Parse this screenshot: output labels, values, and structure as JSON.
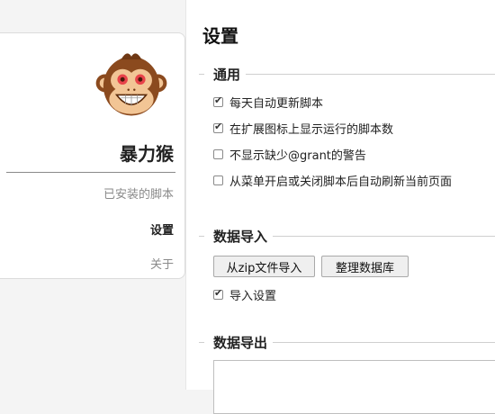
{
  "sidebar": {
    "app_name": "暴力猴",
    "items": [
      {
        "label": "已安装的脚本",
        "active": false
      },
      {
        "label": "设置",
        "active": true
      },
      {
        "label": "关于",
        "active": false
      }
    ]
  },
  "main": {
    "title": "设置",
    "sections": {
      "general": {
        "title": "通用",
        "options": [
          {
            "label": "每天自动更新脚本",
            "checked": true
          },
          {
            "label": "在扩展图标上显示运行的脚本数",
            "checked": true
          },
          {
            "label": "不显示缺少@grant的警告",
            "checked": false
          },
          {
            "label": "从菜单开启或关闭脚本后自动刷新当前页面",
            "checked": false
          }
        ]
      },
      "import": {
        "title": "数据导入",
        "import_zip_button": "从zip文件导入",
        "vacuum_button": "整理数据库",
        "import_settings_option": {
          "label": "导入设置",
          "checked": true
        }
      },
      "export": {
        "title": "数据导出"
      }
    }
  },
  "icons": {
    "logo": "monkey-logo-icon",
    "checkbox_checked": "checkmark-icon"
  },
  "colors": {
    "sidebar_bg": "#ffffff",
    "page_bg": "#f4f4f4",
    "inactive_nav": "#8a8a8a",
    "logo_fur": "#8b4a1e",
    "logo_face": "#f2c595",
    "logo_eyes": "#e8434a"
  }
}
